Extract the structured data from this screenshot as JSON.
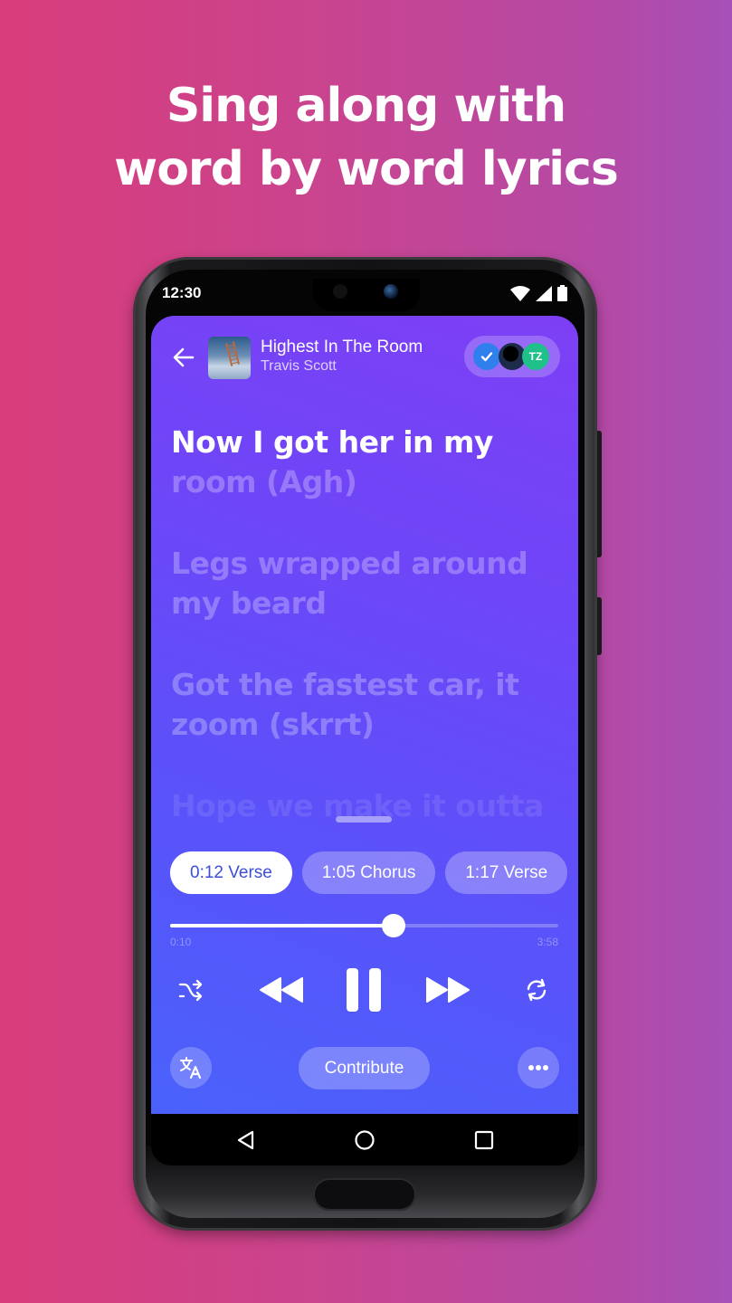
{
  "headline": {
    "line1": "Sing along with",
    "line2": "word by word lyrics"
  },
  "statusbar": {
    "time": "12:30",
    "icons": [
      "wifi-icon",
      "signal-icon",
      "battery-icon"
    ]
  },
  "player": {
    "song_title": "Highest In The Room",
    "artist": "Travis Scott",
    "contributors": [
      {
        "type": "verified",
        "icon": "checkmark-icon",
        "color": "#2f80ed"
      },
      {
        "type": "photo",
        "icon": "silhouette-avatar",
        "color": "#1c2b4a"
      },
      {
        "type": "initials",
        "label": "TZ",
        "color": "#1fc08a"
      }
    ]
  },
  "lyrics": {
    "active": {
      "sung": "Now I got her in my",
      "unsung": "room (Agh)"
    },
    "upcoming": [
      "Legs wrapped around my beard",
      "Got the fastest car, it zoom (skrrt)",
      "Hope we make it outta"
    ]
  },
  "sections": [
    {
      "label": "0:12 Verse",
      "selected": true
    },
    {
      "label": "1:05 Chorus",
      "selected": false
    },
    {
      "label": "1:17 Verse",
      "selected": false
    }
  ],
  "playback": {
    "current_time": "0:10",
    "total_time": "3:58",
    "progress_fraction": 0.575,
    "state": "playing"
  },
  "controls": {
    "shuffle": "shuffle-icon",
    "previous": "rewind-icon",
    "play_pause": "pause-icon",
    "next": "fast-forward-icon",
    "repeat": "repeat-icon"
  },
  "bottom": {
    "translate": "translate-icon",
    "contribute_label": "Contribute",
    "more": "more-icon"
  },
  "navbar": [
    "back-icon",
    "home-icon",
    "recents-icon"
  ],
  "colors": {
    "accent": "#6a48f8",
    "selected_chip_text": "#3b4fd8"
  }
}
